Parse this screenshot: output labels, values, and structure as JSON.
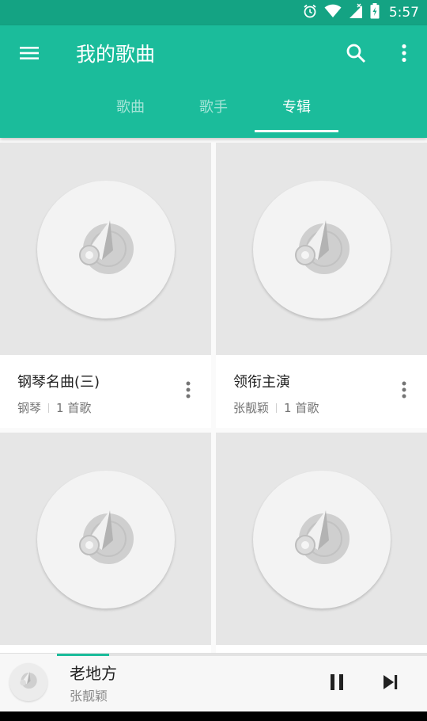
{
  "status_bar": {
    "time": "5:57",
    "icons": [
      "alarm-icon",
      "wifi-icon",
      "signal-icon",
      "battery-icon"
    ]
  },
  "app_bar": {
    "title": "我的歌曲",
    "icons": [
      "menu-icon",
      "search-icon",
      "more-vert-icon"
    ],
    "tabs": [
      {
        "label": "歌曲",
        "active": false
      },
      {
        "label": "歌手",
        "active": false
      },
      {
        "label": "专辑",
        "active": true
      }
    ]
  },
  "albums": [
    {
      "title": "钢琴名曲(三)",
      "artist": "钢琴",
      "count": "1 首歌"
    },
    {
      "title": "领衔主演",
      "artist": "张靓颖",
      "count": "1 首歌"
    },
    {
      "title": "",
      "artist": "",
      "count": ""
    },
    {
      "title": "",
      "artist": "",
      "count": ""
    }
  ],
  "player": {
    "title": "老地方",
    "artist": "张靓颖",
    "progress_fraction": 0.14
  },
  "colors": {
    "primary": "#1bbc9b",
    "status_bar": "#14a383",
    "card_art_bg": "#e6e6e6"
  }
}
